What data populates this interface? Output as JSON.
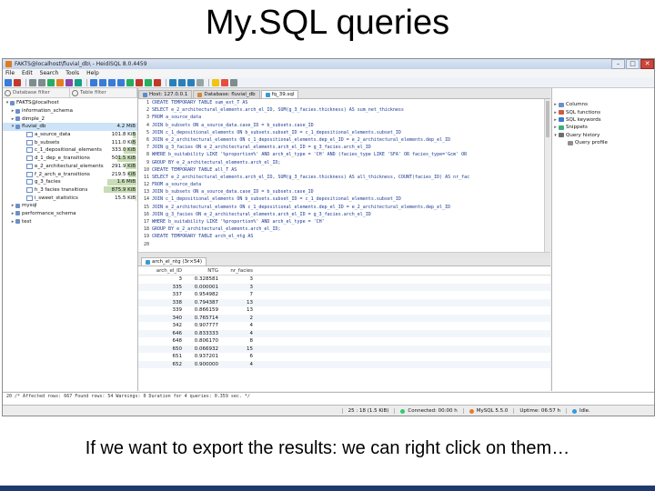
{
  "slide": {
    "title": "My.SQL queries",
    "caption": "If we want to export the results: we can right click on them…"
  },
  "window": {
    "title": "FAKTS@localhost\\fluvial_db\\ - HeidiSQL 8.0.4459",
    "min": "–",
    "max": "□",
    "close": "✕"
  },
  "menu": [
    "File",
    "Edit",
    "Search",
    "Tools",
    "Help"
  ],
  "toolbar_icons": [
    {
      "name": "connect-icon",
      "color": "#3a7bd5"
    },
    {
      "name": "disconnect-icon",
      "color": "#c0392b"
    },
    {
      "name": "copy-icon",
      "color": "#7f8c8d"
    },
    {
      "name": "paste-icon",
      "color": "#7f8c8d"
    },
    {
      "name": "refresh-icon",
      "color": "#27ae60"
    },
    {
      "name": "user-manager-icon",
      "color": "#e67e22"
    },
    {
      "name": "maintenance-icon",
      "color": "#8e44ad"
    },
    {
      "name": "export-icon",
      "color": "#16a085"
    },
    {
      "name": "first-icon",
      "color": "#3a7bd5"
    },
    {
      "name": "prev-icon",
      "color": "#3a7bd5"
    },
    {
      "name": "next-icon",
      "color": "#3a7bd5"
    },
    {
      "name": "last-icon",
      "color": "#3a7bd5"
    },
    {
      "name": "add-row-icon",
      "color": "#27ae60"
    },
    {
      "name": "delete-row-icon",
      "color": "#c0392b"
    },
    {
      "name": "apply-icon",
      "color": "#27ae60"
    },
    {
      "name": "cancel-icon",
      "color": "#c0392b"
    },
    {
      "name": "run-icon",
      "color": "#2980b9"
    },
    {
      "name": "run-selection-icon",
      "color": "#2980b9"
    },
    {
      "name": "explain-icon",
      "color": "#2980b9"
    },
    {
      "name": "format-icon",
      "color": "#95a5a6"
    },
    {
      "name": "help-icon",
      "color": "#f1c40f"
    },
    {
      "name": "donate-icon",
      "color": "#e74c3c"
    },
    {
      "name": "stop-icon",
      "color": "#7f8c8d"
    }
  ],
  "left": {
    "filters": {
      "database": "Database filter",
      "table": "Table filter"
    },
    "tree": [
      {
        "label": "FAKTS@localhost",
        "exp": "▾",
        "type": "server",
        "level": 0
      },
      {
        "label": "information_schema",
        "exp": "▸",
        "type": "db",
        "level": 1
      },
      {
        "label": "dimple_2",
        "exp": "▸",
        "type": "db",
        "level": 1
      },
      {
        "label": "fluvial_db",
        "exp": "▾",
        "type": "db",
        "level": 1,
        "size": "4.2 MiB",
        "selected": true
      },
      {
        "label": "a_source_data",
        "type": "table",
        "level": 2,
        "size": "101.8 KiB",
        "fill": 0.12
      },
      {
        "label": "b_subsets",
        "type": "table",
        "level": 2,
        "size": "111.0 KiB",
        "fill": 0.13
      },
      {
        "label": "c_1_depositional_elements",
        "type": "table",
        "level": 2,
        "size": "333.0 KiB",
        "fill": 0.38
      },
      {
        "label": "d_1_dep_e_transitions",
        "type": "table",
        "level": 2,
        "size": "501.5 KiB",
        "fill": 0.57
      },
      {
        "label": "e_2_architectural_elements",
        "type": "table",
        "level": 2,
        "size": "291.9 KiB",
        "fill": 0.33
      },
      {
        "label": "f_2_arch_e_transitions",
        "type": "table",
        "level": 2,
        "size": "219.5 KiB",
        "fill": 0.25
      },
      {
        "label": "g_3_facies",
        "type": "table",
        "level": 2,
        "size": "1.6 MiB",
        "fill": 0.9
      },
      {
        "label": "h_3 facies transitions",
        "type": "table",
        "level": 2,
        "size": "875.9 KiB",
        "fill": 1.0
      },
      {
        "label": "i_sweet_statistics",
        "type": "table",
        "level": 2,
        "size": "15.5 KiB",
        "fill": 0.02
      },
      {
        "label": "mysql",
        "exp": "▸",
        "type": "db",
        "level": 1
      },
      {
        "label": "performance_schema",
        "exp": "▸",
        "type": "db",
        "level": 1
      },
      {
        "label": "test",
        "exp": "▸",
        "type": "db",
        "level": 1
      }
    ]
  },
  "tabs": [
    {
      "label": "Host: 127.0.0.1",
      "icon": "host-icon",
      "color": "#5b8bd0"
    },
    {
      "label": "Database: fluvial_db",
      "icon": "database-icon",
      "color": "#d08b3b"
    },
    {
      "label": "fq_39.sql",
      "icon": "query-icon",
      "color": "#3b9bd0",
      "active": true
    }
  ],
  "editor": {
    "lines": [
      "CREATE TEMPORARY TABLE sum_ext_T AS",
      "SELECT e_2_architectural_elements.arch_el_ID, SUM(g_3_facies.thickness) AS sum_net_thickness",
      "FROM a_source_data",
      "JOIN b_subsets ON a_source_data.case_ID = b_subsets.case_ID",
      "JOIN c_1_depositional_elements ON b_subsets.subset_ID = c_1_depositional_elements.subset_ID",
      "JOIN e_2_architectural_elements ON c_1_depositional_elements.dep_el_ID = e_2_architectural_elements.dep_el_ID",
      "JOIN g_3_facies ON e_2_architectural_elements.arch_el_ID = g_3_facies.arch_el_ID",
      "WHERE b_suitability LIKE '%proportion%' AND arch_el_type = 'CH' AND (facies_type LIKE 'SFA' OR facies_type='Gcm' OR",
      "GROUP BY e_2_architectural_elements.arch_el_ID;",
      "CREATE TEMPORARY TABLE all_T AS",
      "SELECT e_2_architectural_elements.arch_el_ID, SUM(g_3_facies.thickness) AS all_thickness, COUNT(facies_ID) AS nr_fac",
      "FROM a_source_data",
      "JOIN b_subsets ON a_source_data.case_ID = b_subsets.case_ID",
      "JOIN c_1_depositional_elements ON b_subsets.subset_ID = c_1_depositional_elements.subset_ID",
      "JOIN e_2_architectural_elements ON c_1_depositional_elements.dep_el_ID = e_2_architectural_elements.dep_el_ID",
      "JOIN g_3_facies ON e_2_architectural_elements.arch_el_ID = g_3_facies.arch_el_ID",
      "WHERE b_suitability LIKE '%proportion%' AND arch_el_type = 'CH'",
      "GROUP BY e_2_architectural_elements.arch_el_ID;",
      "CREATE TEMPORARY TABLE arch_el_ntg AS",
      ""
    ]
  },
  "results": {
    "tab_label": "arch_el_ntg (3r×54)",
    "headers": [
      "arch_el_ID",
      "NTG",
      "nr_facies"
    ],
    "rows": [
      [
        "3",
        "0.328581",
        "3"
      ],
      [
        "335",
        "0.000001",
        "3"
      ],
      [
        "337",
        "0.954982",
        "7"
      ],
      [
        "338",
        "0.794387",
        "13"
      ],
      [
        "339",
        "0.866159",
        "13"
      ],
      [
        "340",
        "0.765714",
        "2"
      ],
      [
        "342",
        "0.907777",
        "4"
      ],
      [
        "646",
        "0.833333",
        "4"
      ],
      [
        "648",
        "0.806170",
        "8"
      ],
      [
        "650",
        "0.066932",
        "15"
      ],
      [
        "651",
        "0.937201",
        "6"
      ],
      [
        "652",
        "0.900000",
        "4"
      ]
    ]
  },
  "helpers": [
    {
      "label": "Columns",
      "exp": "▸",
      "color": "#6d8fc7",
      "sub": false
    },
    {
      "label": "SQL functions",
      "exp": "▸",
      "color": "#d05b3b",
      "sub": false
    },
    {
      "label": "SQL keywords",
      "exp": "▸",
      "color": "#3b7bd0",
      "sub": false
    },
    {
      "label": "Snippets",
      "exp": "▸",
      "color": "#3bb07b",
      "sub": false
    },
    {
      "label": "Query history",
      "exp": "▾",
      "color": "#6d6d6d",
      "sub": false
    },
    {
      "label": "Query profile",
      "exp": "",
      "color": "#909090",
      "sub": true
    }
  ],
  "log": "20 /* Affected rows: 667  Found rows: 54  Warnings: 0  Duration for 4 queries: 0.359 sec. */",
  "status": {
    "position": "25 : 18 (1.5 KiB)",
    "connected": "Connected: 00:00 h",
    "server": "MySQL 5.5.0",
    "uptime": "Uptime: 06:57 h",
    "idle": "Idle."
  }
}
